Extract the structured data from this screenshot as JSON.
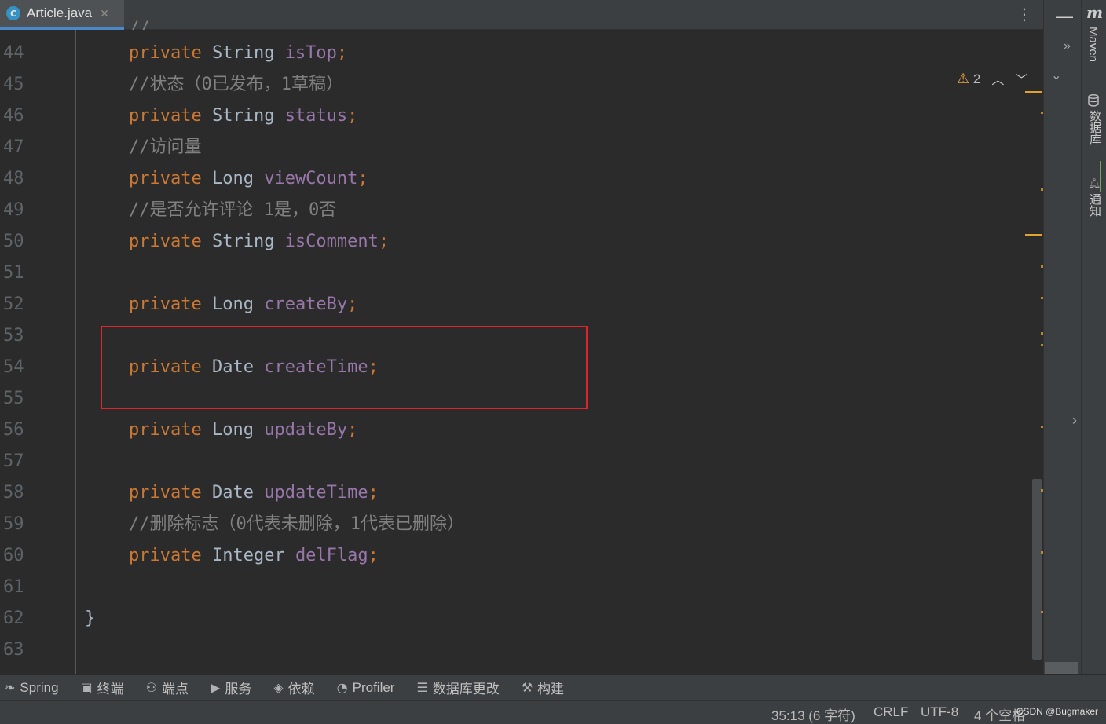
{
  "tab": {
    "icon": "C",
    "label": "Article.java",
    "close": "✕"
  },
  "inspection": {
    "warning_count": "2"
  },
  "side_tabs": {
    "maven": "Maven",
    "database": "数据库",
    "notifications": "通知"
  },
  "code_lines": [
    {
      "n": "44",
      "parts": [
        [
          "kw",
          "private "
        ],
        [
          "ty",
          "String "
        ],
        [
          "fd",
          "isTop"
        ],
        [
          "pn",
          ";"
        ]
      ]
    },
    {
      "n": "45",
      "parts": [
        [
          "cm",
          "//状态（0已发布，1草稿）"
        ]
      ]
    },
    {
      "n": "46",
      "parts": [
        [
          "kw",
          "private "
        ],
        [
          "ty",
          "String "
        ],
        [
          "fd",
          "status"
        ],
        [
          "pn",
          ";"
        ]
      ]
    },
    {
      "n": "47",
      "parts": [
        [
          "cm",
          "//访问量"
        ]
      ]
    },
    {
      "n": "48",
      "parts": [
        [
          "kw",
          "private "
        ],
        [
          "ty",
          "Long "
        ],
        [
          "fd",
          "viewCount"
        ],
        [
          "pn",
          ";"
        ]
      ]
    },
    {
      "n": "49",
      "parts": [
        [
          "cm",
          "//是否允许评论 1是，0否"
        ]
      ]
    },
    {
      "n": "50",
      "parts": [
        [
          "kw",
          "private "
        ],
        [
          "ty",
          "String "
        ],
        [
          "fd",
          "isComment"
        ],
        [
          "pn",
          ";"
        ]
      ]
    },
    {
      "n": "51",
      "parts": []
    },
    {
      "n": "52",
      "parts": [
        [
          "kw",
          "private "
        ],
        [
          "ty",
          "Long "
        ],
        [
          "fd",
          "createBy"
        ],
        [
          "pn",
          ";"
        ]
      ]
    },
    {
      "n": "53",
      "parts": []
    },
    {
      "n": "54",
      "parts": [
        [
          "kw",
          "private "
        ],
        [
          "ty",
          "Date "
        ],
        [
          "fd",
          "createTime"
        ],
        [
          "pn",
          ";"
        ]
      ]
    },
    {
      "n": "55",
      "parts": []
    },
    {
      "n": "56",
      "parts": [
        [
          "kw",
          "private "
        ],
        [
          "ty",
          "Long "
        ],
        [
          "fd",
          "updateBy"
        ],
        [
          "pn",
          ";"
        ]
      ]
    },
    {
      "n": "57",
      "parts": []
    },
    {
      "n": "58",
      "parts": [
        [
          "kw",
          "private "
        ],
        [
          "ty",
          "Date "
        ],
        [
          "fd",
          "updateTime"
        ],
        [
          "pn",
          ";"
        ]
      ]
    },
    {
      "n": "59",
      "parts": [
        [
          "cm",
          "//删除标志（0代表未删除，1代表已删除）"
        ]
      ]
    },
    {
      "n": "60",
      "parts": [
        [
          "kw",
          "private "
        ],
        [
          "ty",
          "Integer "
        ],
        [
          "fd",
          "delFlag"
        ],
        [
          "pn",
          ";"
        ]
      ]
    },
    {
      "n": "61",
      "parts": []
    },
    {
      "n": "62",
      "parts": [
        [
          "br",
          "}"
        ]
      ],
      "brace": true
    },
    {
      "n": "63",
      "parts": []
    }
  ],
  "tool_windows": [
    {
      "icon": "spring-icon",
      "glyph": "❧",
      "label": "Spring"
    },
    {
      "icon": "terminal-icon",
      "glyph": "▣",
      "label": "终端"
    },
    {
      "icon": "endpoints-icon",
      "glyph": "⚇",
      "label": "端点"
    },
    {
      "icon": "services-icon",
      "glyph": "▶",
      "label": "服务"
    },
    {
      "icon": "dependencies-icon",
      "glyph": "◈",
      "label": "依赖"
    },
    {
      "icon": "profiler-icon",
      "glyph": "◔",
      "label": "Profiler"
    },
    {
      "icon": "database-changes-icon",
      "glyph": "☰",
      "label": "数据库更改"
    },
    {
      "icon": "build-icon",
      "glyph": "⚒",
      "label": "构建"
    }
  ],
  "status_bar": {
    "position": "35:13 (6 字符)",
    "line_sep": "CRLF",
    "encoding": "UTF-8",
    "indent": "4 个空格",
    "watermark": "CSDN @Bugmaker"
  },
  "colors": {
    "keyword": "#cc7832",
    "type": "#a9b7c6",
    "field": "#9876aa",
    "comment": "#808080",
    "highlight_box": "#e0242b"
  }
}
